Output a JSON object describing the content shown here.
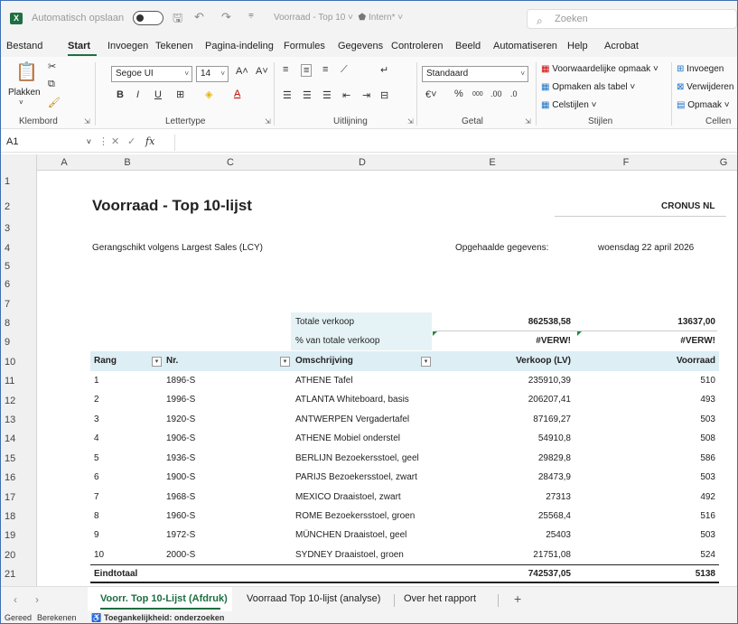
{
  "titlebar": {
    "app_icon": "X",
    "autosave_label": "Automatisch opslaan",
    "doc_title": "Voorraad - Top 10",
    "sensitivity": "Intern*",
    "search_placeholder": "Zoeken"
  },
  "menu": [
    "Bestand",
    "Start",
    "Invoegen",
    "Tekenen",
    "Pagina-indeling",
    "Formules",
    "Gegevens",
    "Controleren",
    "Beeld",
    "Automatiseren",
    "Help",
    "Acrobat"
  ],
  "ribbon": {
    "clipboard": {
      "paste": "Plakken",
      "label": "Klembord"
    },
    "font": {
      "name": "Segoe UI",
      "size": "14",
      "label": "Lettertype"
    },
    "alignment": {
      "label": "Uitlijning"
    },
    "number": {
      "format": "Standaard",
      "label": "Getal"
    },
    "styles": {
      "cond": "Voorwaardelijke opmaak",
      "table": "Opmaken als tabel",
      "cell": "Celstijlen",
      "label": "Stijlen"
    },
    "cells": {
      "insert": "Invoegen",
      "delete": "Verwijderen",
      "format": "Opmaak",
      "label": "Cellen"
    }
  },
  "formula_bar": {
    "cell_ref": "A1",
    "fx": "fx"
  },
  "columns": [
    "A",
    "B",
    "C",
    "D",
    "E",
    "F",
    "G"
  ],
  "rows": [
    "1",
    "2",
    "3",
    "4",
    "5",
    "6",
    "7",
    "8",
    "9",
    "10",
    "11",
    "12",
    "13",
    "14",
    "15",
    "16",
    "17",
    "18",
    "19",
    "20",
    "21"
  ],
  "report": {
    "title": "Voorraad - Top 10-lijst",
    "company": "CRONUS NL",
    "ranked_by": "Gerangschikt volgens Largest Sales (LCY)",
    "retrieved_label": "Opgehaalde gegevens:",
    "retrieved_date": "woensdag 22 april 2026",
    "total_sales_label": "Totale verkoop",
    "total_sales_value": "862538,58",
    "total_stock_value": "13637,00",
    "pct_label": "% van totale verkoop",
    "pct_value1": "#VERW!",
    "pct_value2": "#VERW!"
  },
  "table": {
    "headers": {
      "rank": "Rang",
      "no": "Nr.",
      "desc": "Omschrijving",
      "sales": "Verkoop (LV)",
      "stock": "Voorraad"
    },
    "rows": [
      {
        "rank": "1",
        "no": "1896-S",
        "desc": "ATHENE Tafel",
        "sales": "235910,39",
        "stock": "510"
      },
      {
        "rank": "2",
        "no": "1996-S",
        "desc": "ATLANTA Whiteboard, basis",
        "sales": "206207,41",
        "stock": "493"
      },
      {
        "rank": "3",
        "no": "1920-S",
        "desc": "ANTWERPEN Vergadertafel",
        "sales": "87169,27",
        "stock": "503"
      },
      {
        "rank": "4",
        "no": "1906-S",
        "desc": "ATHENE Mobiel onderstel",
        "sales": "54910,8",
        "stock": "508"
      },
      {
        "rank": "5",
        "no": "1936-S",
        "desc": "BERLIJN Bezoekersstoel, geel",
        "sales": "29829,8",
        "stock": "586"
      },
      {
        "rank": "6",
        "no": "1900-S",
        "desc": "PARIJS Bezoekersstoel, zwart",
        "sales": "28473,9",
        "stock": "503"
      },
      {
        "rank": "7",
        "no": "1968-S",
        "desc": "MEXICO Draaistoel, zwart",
        "sales": "27313",
        "stock": "492"
      },
      {
        "rank": "8",
        "no": "1960-S",
        "desc": "ROME Bezoekersstoel, groen",
        "sales": "25568,4",
        "stock": "516"
      },
      {
        "rank": "9",
        "no": "1972-S",
        "desc": "MÜNCHEN Draaistoel, geel",
        "sales": "25403",
        "stock": "503"
      },
      {
        "rank": "10",
        "no": "2000-S",
        "desc": "SYDNEY Draaistoel, groen",
        "sales": "21751,08",
        "stock": "524"
      }
    ],
    "total": {
      "label": "Eindtotaal",
      "sales": "742537,05",
      "stock": "5138"
    }
  },
  "sheet_tabs": [
    "Voorr. Top 10-Lijst (Afdruk)",
    "Voorraad Top 10-lijst (analyse)",
    "Over het rapport"
  ],
  "status": {
    "ready": "Gereed",
    "calc": "Berekenen",
    "access": "Toegankelijkheid: onderzoeken"
  }
}
